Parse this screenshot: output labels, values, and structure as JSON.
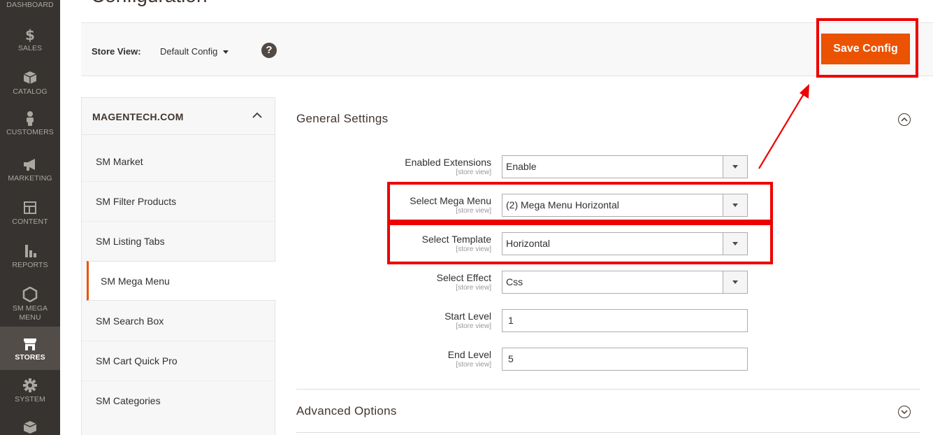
{
  "page": {
    "title": "Configuration"
  },
  "nav": {
    "items": [
      {
        "label": "DASHBOARD",
        "icon": "dashboard-icon"
      },
      {
        "label": "SALES",
        "icon": "dollar-icon"
      },
      {
        "label": "CATALOG",
        "icon": "box-icon"
      },
      {
        "label": "CUSTOMERS",
        "icon": "person-icon"
      },
      {
        "label": "MARKETING",
        "icon": "megaphone-icon"
      },
      {
        "label": "CONTENT",
        "icon": "layout-icon"
      },
      {
        "label": "REPORTS",
        "icon": "bar-chart-icon"
      },
      {
        "label": "SM MEGA MENU",
        "icon": "hexagon-icon"
      },
      {
        "label": "STORES",
        "icon": "store-icon",
        "active": true
      },
      {
        "label": "SYSTEM",
        "icon": "gear-icon"
      },
      {
        "label": "",
        "icon": "extensions-icon"
      }
    ]
  },
  "store_bar": {
    "label": "Store View:",
    "value": "Default Config",
    "help": "?",
    "save_label": "Save Config"
  },
  "tabs": {
    "group_title": "MAGENTECH.COM",
    "items": [
      {
        "label": "SM Market"
      },
      {
        "label": "SM Filter Products"
      },
      {
        "label": "SM Listing Tabs"
      },
      {
        "label": "SM Mega Menu",
        "active": true
      },
      {
        "label": "SM Search Box"
      },
      {
        "label": "SM Cart Quick Pro"
      },
      {
        "label": "SM Categories"
      }
    ]
  },
  "general": {
    "title": "General Settings",
    "fields": [
      {
        "label": "Enabled Extensions",
        "scope": "[store view]",
        "value": "Enable"
      },
      {
        "label": "Select Mega Menu",
        "scope": "[store view]",
        "value": "(2) Mega Menu Horizontal"
      },
      {
        "label": "Select Template",
        "scope": "[store view]",
        "value": "Horizontal"
      },
      {
        "label": "Select Effect",
        "scope": "[store view]",
        "value": "Css"
      },
      {
        "label": "Start Level",
        "scope": "[store view]",
        "value": "1"
      },
      {
        "label": "End Level",
        "scope": "[store view]",
        "value": "5"
      }
    ]
  },
  "advanced": {
    "title": "Advanced Options"
  },
  "colors": {
    "accent": "#eb5202",
    "annotation": "#ee0000",
    "nav_bg": "#373330"
  }
}
